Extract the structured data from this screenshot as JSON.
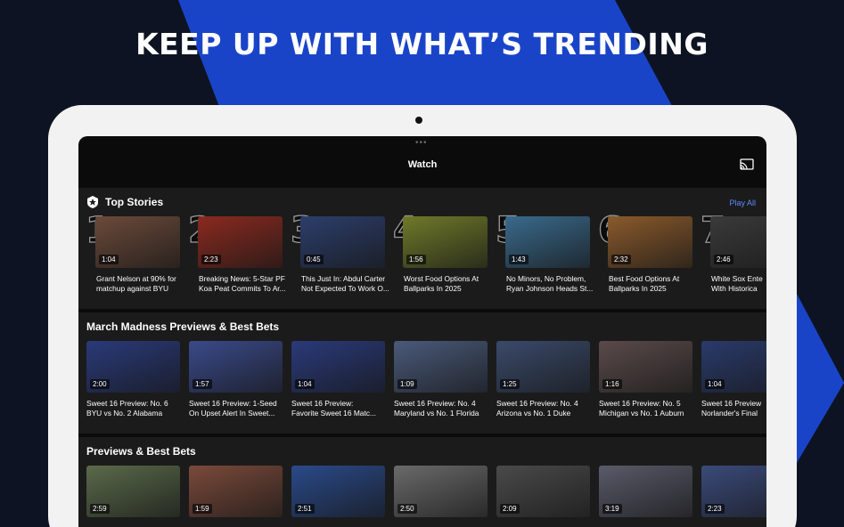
{
  "headline": "KEEP UP WITH WHAT’S TRENDING",
  "app": {
    "title": "Watch"
  },
  "top_stories": {
    "title": "Top Stories",
    "play_all": "Play All",
    "items": [
      {
        "rank": "1",
        "duration": "1:04",
        "line1": "Grant Nelson at 90% for",
        "line2": "matchup against BYU",
        "color": "#6b4a3a"
      },
      {
        "rank": "2",
        "duration": "2:23",
        "line1": "Breaking News: 5-Star PF",
        "line2": "Koa Peat Commits To Ar...",
        "color": "#8a2a20"
      },
      {
        "rank": "3",
        "duration": "0:45",
        "line1": "This Just In: Abdul Carter",
        "line2": "Not Expected To Work O...",
        "color": "#2c3e6b"
      },
      {
        "rank": "4",
        "duration": "1:56",
        "line1": "Worst Food Options At",
        "line2": "Ballparks In 2025",
        "color": "#6f7a2a"
      },
      {
        "rank": "5",
        "duration": "1:43",
        "line1": "No Minors, No Problem,",
        "line2": "Ryan Johnson Heads St...",
        "color": "#3a6a8c"
      },
      {
        "rank": "6",
        "duration": "2:32",
        "line1": "Best Food Options At",
        "line2": "Ballparks In 2025",
        "color": "#8a5a2c"
      },
      {
        "rank": "7",
        "duration": "2:46",
        "line1": "White Sox Ente",
        "line2": "With Historica",
        "color": "#3a3a3a"
      }
    ]
  },
  "march_madness": {
    "title": "March Madness Previews & Best Bets",
    "items": [
      {
        "duration": "2:00",
        "line1": "Sweet 16 Preview: No. 6",
        "line2": "BYU vs No. 2 Alabama",
        "color": "#2a3a7a"
      },
      {
        "duration": "1:57",
        "line1": "Sweet 16 Preview: 1-Seed",
        "line2": "On Upset Alert In Sweet...",
        "color": "#3a4a8a"
      },
      {
        "duration": "1:04",
        "line1": "Sweet 16 Preview:",
        "line2": "Favorite Sweet 16 Matc...",
        "color": "#2a3a7a"
      },
      {
        "duration": "1:09",
        "line1": "Sweet 16 Preview: No. 4",
        "line2": "Maryland vs No. 1 Florida",
        "color": "#4a5a7a"
      },
      {
        "duration": "1:25",
        "line1": "Sweet 16 Preview: No. 4",
        "line2": "Arizona vs No. 1 Duke",
        "color": "#3a4a6a"
      },
      {
        "duration": "1:16",
        "line1": "Sweet 16 Preview: No. 5",
        "line2": "Michigan vs No. 1 Auburn",
        "color": "#5a4a4a"
      },
      {
        "duration": "1:04",
        "line1": "Sweet 16 Preview",
        "line2": "Norlander's Final",
        "color": "#2a3a6a"
      }
    ]
  },
  "previews": {
    "title": "Previews & Best Bets",
    "items": [
      {
        "duration": "2:59",
        "color": "#5a6a4a"
      },
      {
        "duration": "1:59",
        "color": "#7a4a3a"
      },
      {
        "duration": "2:51",
        "color": "#2a4a8a"
      },
      {
        "duration": "2:50",
        "color": "#6a6a6a"
      },
      {
        "duration": "2:09",
        "color": "#4a4a4a"
      },
      {
        "duration": "3:19",
        "color": "#5a5a6a"
      },
      {
        "duration": "2:23",
        "color": "#3a4a7a"
      }
    ]
  }
}
